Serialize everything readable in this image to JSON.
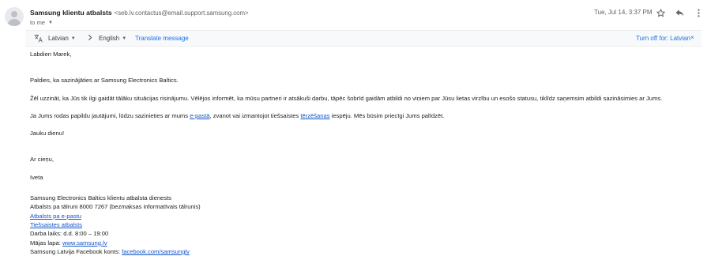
{
  "header": {
    "sender_name": "Samsung klientu atbalsts",
    "sender_email": "<seb.lv.contactus@email.support.samsung.com>",
    "to_label": "to me",
    "date": "Tue, Jul 14, 3:37 PM",
    "icons": [
      "avatar",
      "star-icon",
      "reply-icon",
      "more-vert-icon",
      "chevron-down-icon"
    ]
  },
  "translate_bar": {
    "source_language": "Latvian",
    "target_language": "English",
    "translate_label": "Translate message",
    "turn_off_label": "Turn off for: Latvian",
    "close_symbol": "×",
    "icons": [
      "translate-icon",
      "arrow-right-icon",
      "close-icon"
    ]
  },
  "body": {
    "greeting": "Labdien Marek,",
    "thanks": "Paldies, ka sazinājāties ar Samsung Electronics Baltics.",
    "regret": "Žēl uzzināt, ka Jūs tik ilgi gaidāt tālāku situācijas risinājumu. Vēlējos informēt, ka mūsu partneri ir atsākuši darbu, tāpēc šobrīd gaidām atbildi no viņiem par Jūsu lietas virzību un esošo statusu, tiklīdz saņemsim atbildi sazināsimies ar Jums.",
    "contact_prefix": "Ja Jums rodas papildu jautājumi, lūdzu sazinieties ar mums",
    "contact_email_link": "e-pastā",
    "contact_middle": ", zvanot vai izmantojot tiešsaistes",
    "contact_chat_link": "tērzēšanas",
    "contact_suffix": "iespēju. Mēs būsim  priecīgi Jums palīdzēt.",
    "good_day": "Jauku dienu!",
    "regards": "Ar cieņu,",
    "name": "Iveta"
  },
  "signature": {
    "company": "Samsung Electronics Baltics klientu atbalsta dienests",
    "phone": "Atbalsts pa tālruni 8000 7267 (bezmaksas informatīvais tālrunis)",
    "email_link": "Atbalsts pa e-pastu",
    "chat_link": "Tiešsaistes atbalsts",
    "hours": "Darba laiks: d.d. 8:00 – 19:00",
    "homepage_label": "Mājas lapa:",
    "homepage_link": "www.samsung.lv",
    "facebook_label": "Samsung Latvija Facebook konts:",
    "facebook_link": "facebook.com/samsunglv"
  },
  "colors": {
    "link": "#1155cc",
    "accent": "#1a73e8",
    "translate_bar_bg": "#f8f9fa"
  }
}
